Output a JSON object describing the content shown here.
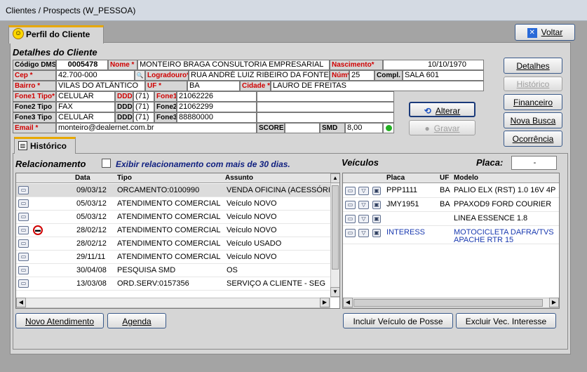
{
  "window_title": "Clientes / Prospects (W_PESSOA)",
  "tab_label": "Perfil do Cliente",
  "buttons": {
    "voltar": "Voltar",
    "detalhes": "Detalhes",
    "historico": "Histórico",
    "financeiro": "Financeiro",
    "nova_busca": "Nova Busca",
    "ocorrencia": "Ocorrência",
    "alterar": "Alterar",
    "gravar": "Gravar",
    "novo_atendimento": "Novo Atendimento",
    "agenda": "Agenda",
    "incluir_veiculo": "Incluir Veículo de Posse",
    "excluir_vec": "Excluir Vec. Interesse"
  },
  "section_title": "Detalhes do Cliente",
  "fields": {
    "codigo_dms_label": "Código DMS",
    "codigo_dms": "0005478",
    "nome_label": "Nome *",
    "nome": "MONTEIRO BRAGA CONSULTORIA EMPRESARIAL",
    "nascimento_label": "Nascimento*",
    "nascimento": "10/10/1970",
    "cep_label": "Cep *",
    "cep": "42.700-000",
    "logradouro_label": "Logradouro*",
    "logradouro": "RUA ANDRÉ LUIZ RIBEIRO DA FONTE",
    "num_label": "Núm*",
    "num": "25",
    "compl_label": "Compl.",
    "compl": "SALA 601",
    "bairro_label": "Bairro *",
    "bairro": "VILAS DO ATLÂNTICO",
    "uf_label": "UF *",
    "uf": "BA",
    "cidade_label": "Cidade *",
    "cidade": "LAURO DE FREITAS",
    "fone1_tipo_label": "Fone1 Tipo*",
    "fone1_tipo": "CELULAR",
    "ddd_label": "DDD",
    "ddd1": "(71)",
    "fone1_label": "Fone1",
    "fone1": "21062226",
    "fone2_tipo_label": "Fone2 Tipo",
    "fone2_tipo": "FAX",
    "ddd2": "(71)",
    "fone2_label": "Fone2",
    "fone2": "21062299",
    "fone3_tipo_label": "Fone3 Tipo",
    "fone3_tipo": "CELULAR",
    "ddd3": "(71)",
    "fone3_label": "Fone3",
    "fone3": "88880000",
    "email_label": "Email *",
    "email": "monteiro@dealernet.com.br",
    "score_label": "SCORE",
    "score": "",
    "smd_label": "SMD",
    "smd": "8,00"
  },
  "historico_tab": "Histórico",
  "relacionamento": {
    "title": "Relacionamento",
    "checkbox_label": "Exibir relacionamento com mais de 30 dias.",
    "columns": [
      "Data",
      "Tipo",
      "Assunto"
    ],
    "rows": [
      {
        "data": "09/03/12",
        "tipo": "ORCAMENTO:0100990",
        "assunto": "VENDA OFICINA (ACESSÓRI"
      },
      {
        "data": "05/03/12",
        "tipo": "ATENDIMENTO COMERCIAL",
        "assunto": "Veículo NOVO"
      },
      {
        "data": "05/03/12",
        "tipo": "ATENDIMENTO COMERCIAL",
        "assunto": "Veículo NOVO"
      },
      {
        "data": "28/02/12",
        "tipo": "ATENDIMENTO COMERCIAL",
        "assunto": "Veículo NOVO"
      },
      {
        "data": "28/02/12",
        "tipo": "ATENDIMENTO COMERCIAL",
        "assunto": "Veículo USADO"
      },
      {
        "data": "29/11/11",
        "tipo": "ATENDIMENTO COMERCIAL",
        "assunto": "Veículo NOVO"
      },
      {
        "data": "30/04/08",
        "tipo": "PESQUISA SMD",
        "assunto": "OS"
      },
      {
        "data": "13/03/08",
        "tipo": "ORD.SERV:0157356",
        "assunto": "SERVIÇO A CLIENTE - SEG"
      }
    ]
  },
  "veiculos": {
    "title": "Veículos",
    "placa_label": "Placa:",
    "placa_value": "-",
    "columns": [
      "Placa",
      "UF",
      "Modelo"
    ],
    "rows": [
      {
        "placa": "PPP1111",
        "uf": "BA",
        "modelo": "PALIO ELX (RST) 1.0 16V 4P"
      },
      {
        "placa": "JMY1951",
        "uf": "BA",
        "modelo": "PPAXOD9 FORD COURIER"
      },
      {
        "placa": "",
        "uf": "",
        "modelo": "LINEA ESSENCE 1.8"
      },
      {
        "placa": "INTERESS",
        "uf": "",
        "modelo": "MOTOCICLETA DAFRA/TVS",
        "modelo2": "APACHE RTR 15"
      }
    ]
  },
  "colors": {
    "label_red": "#d00000",
    "interest_blue": "#1a3ab0",
    "accent_orange": "#e8a800"
  }
}
